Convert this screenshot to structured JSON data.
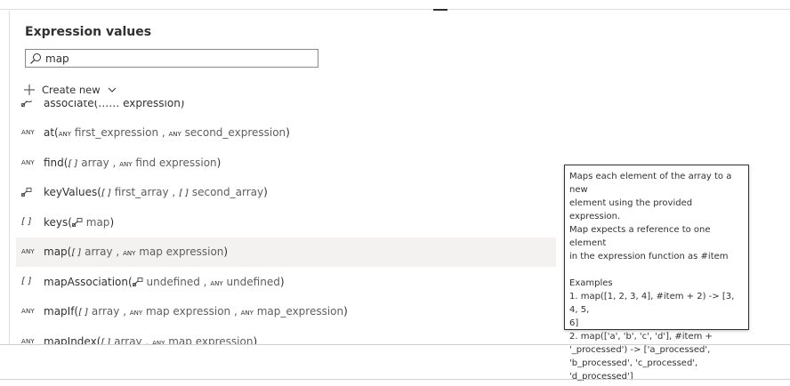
{
  "panel": {
    "title": "Expression values"
  },
  "search": {
    "value": "map",
    "placeholder": ""
  },
  "create_new": {
    "label": "Create new"
  },
  "list": {
    "cut_row": {
      "name": "associate",
      "text": "associate(…… expression)"
    },
    "rows": [
      {
        "id": "at",
        "type": "ANY",
        "name": "at",
        "args": [
          {
            "type": "ANY",
            "name": "first_expression"
          },
          {
            "type": "ANY",
            "name": "second_expression"
          }
        ]
      },
      {
        "id": "find",
        "type": "ANY",
        "name": "find",
        "args": [
          {
            "type": "[ ]",
            "name": "array"
          },
          {
            "type": "ANY",
            "name": "find expression"
          }
        ]
      },
      {
        "id": "keyvalues",
        "type": "map",
        "name": "keyValues",
        "args": [
          {
            "type": "[ ]",
            "name": "first_array"
          },
          {
            "type": "[ ]",
            "name": "second_array"
          }
        ]
      },
      {
        "id": "keys",
        "type": "[ ]",
        "name": "keys",
        "args": [
          {
            "type": "map",
            "name": "map"
          }
        ]
      },
      {
        "id": "map",
        "type": "ANY",
        "name": "map",
        "selected": true,
        "args": [
          {
            "type": "[ ]",
            "name": "array"
          },
          {
            "type": "ANY",
            "name": "map expression"
          }
        ]
      },
      {
        "id": "mapassociation",
        "type": "[ ]",
        "name": "mapAssociation",
        "args": [
          {
            "type": "map",
            "name": "undefined"
          },
          {
            "type": "ANY",
            "name": "undefined"
          }
        ]
      },
      {
        "id": "mapif",
        "type": "ANY",
        "name": "mapIf",
        "args": [
          {
            "type": "[ ]",
            "name": "array"
          },
          {
            "type": "ANY",
            "name": "map expression"
          },
          {
            "type": "ANY",
            "name": "map_expression"
          }
        ]
      },
      {
        "id": "mapindex",
        "type": "ANY",
        "name": "mapIndex",
        "args": [
          {
            "type": "[ ]",
            "name": "array"
          },
          {
            "type": "ANY",
            "name": "map expression"
          }
        ]
      }
    ]
  },
  "tooltip": {
    "line1": "Maps each element of the array to a new",
    "line2": "element using the provided expression.",
    "line3": "Map expects a reference to one element",
    "line4": "in the expression function as #item",
    "examples_label": "Examples",
    "ex1a": "1. map([1, 2, 3, 4], #item + 2) -> [3, 4, 5,",
    "ex1b": "6]",
    "ex2a": "2. map(['a', 'b', 'c', 'd'], #item +",
    "ex2b": "'_processed') -> ['a_processed',",
    "ex2c": "'b_processed', 'c_processed',",
    "ex2d": "'d_processed']"
  },
  "icons": {
    "search": "search-icon",
    "plus": "plus-icon",
    "chevron": "chevron-down-icon",
    "map_type": "map-type-icon"
  },
  "colors": {
    "text": "#323130",
    "selected_row": "#f3f2f1",
    "border": "#8a8886"
  }
}
